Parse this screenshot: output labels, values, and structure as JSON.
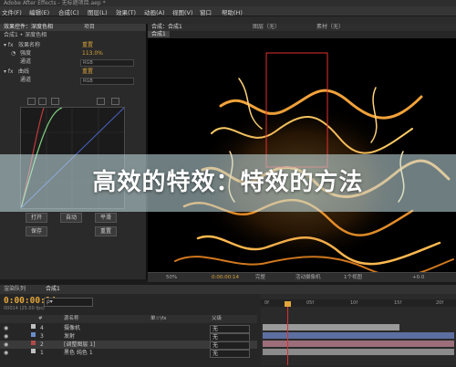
{
  "app": {
    "title": "Adobe After Effects - 无标题项目.aep *"
  },
  "menu": [
    "文件(F)",
    "编辑(E)",
    "合成(C)",
    "图层(L)",
    "效果(T)",
    "动画(A)",
    "视图(V)",
    "窗口",
    "帮助(H)"
  ],
  "effect_panel": {
    "tabs": [
      "效果控件：深度色相",
      "项目"
    ],
    "header": "合成1 • 深度色相",
    "rows": [
      {
        "label": "效果名称",
        "value": "重置"
      },
      {
        "label": "强度",
        "value": "113.0%"
      },
      {
        "label": "通道",
        "dropdown": "RGB"
      },
      {
        "label": "曲线",
        "value": "重置"
      },
      {
        "label": "通道",
        "dropdown": "RGB"
      }
    ],
    "buttons": [
      "打开",
      "自动",
      "平滑",
      "保存",
      "重置"
    ]
  },
  "composition": {
    "tabs": [
      "合成：合成1",
      "图层（无）",
      "素材（无）"
    ],
    "breadcrumb": "合成1",
    "footer": [
      "50%",
      "0:00:00:14",
      "完整",
      "活动摄像机",
      "1个视图",
      "+0.0"
    ]
  },
  "banner": {
    "text": "高效的特效：特效的方法"
  },
  "timeline": {
    "tabs": [
      "渲染队列",
      "合成1"
    ],
    "timecode": "0:00:00:14",
    "timecode_sub": "00014 (25.00 fps)",
    "search": "ρ▾",
    "header": {
      "num": "#",
      "name": "源名称",
      "switches": "单☆\\fx",
      "parent": "父级"
    },
    "layers": [
      {
        "num": "1",
        "name": "黑色 纯色 1",
        "parent": "无",
        "color": "#c0c0c0"
      },
      {
        "num": "2",
        "name": "[调整图层 1]",
        "parent": "无",
        "color": "#b04a4a"
      },
      {
        "num": "3",
        "name": "发射",
        "parent": "无",
        "color": "#6a8ec8"
      },
      {
        "num": "4",
        "name": "摄像机",
        "parent": "无",
        "color": "#c9c9c9"
      }
    ],
    "ruler": [
      "0f",
      "05f",
      "10f",
      "15f",
      "20f"
    ]
  },
  "colors": {
    "accent_time": "#e3a63a",
    "banner_bg": "#c8e4e8",
    "fire": "#f2a23a",
    "selection_box": "#e03030"
  }
}
